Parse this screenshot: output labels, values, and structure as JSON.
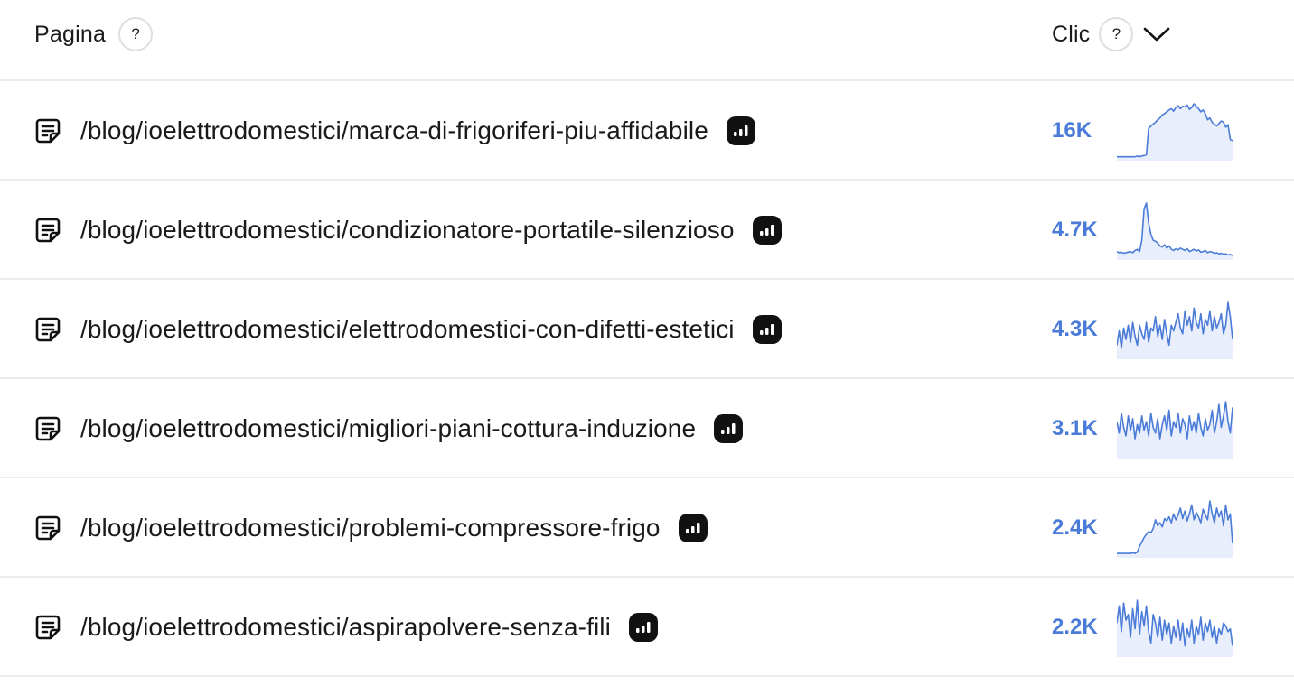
{
  "header": {
    "page_label": "Pagina",
    "clicks_label": "Clic",
    "help_glyph": "?"
  },
  "colors": {
    "accent": "#4a7bd8",
    "spark_fill": "#e8eefb",
    "badge_bg": "#111111",
    "divider": "#ececec"
  },
  "rows": [
    {
      "url": "/blog/ioelettrodomestici/marca-di-frigoriferi-piu-affidabile",
      "clicks": "16K",
      "trend": [
        2,
        2,
        2,
        2,
        2,
        2,
        2,
        2,
        2,
        3,
        2,
        3,
        4,
        5,
        48,
        52,
        55,
        58,
        62,
        65,
        70,
        72,
        75,
        78,
        80,
        76,
        82,
        85,
        80,
        84,
        83,
        86,
        79,
        82,
        88,
        84,
        80,
        75,
        78,
        72,
        62,
        65,
        58,
        55,
        52,
        56,
        60,
        58,
        50,
        54,
        30,
        28
      ]
    },
    {
      "url": "/blog/ioelettrodomestici/condizionatore-portatile-silenzioso",
      "clicks": "4.7K",
      "trend": [
        10,
        8,
        9,
        7,
        8,
        9,
        10,
        8,
        12,
        14,
        10,
        30,
        85,
        95,
        60,
        40,
        30,
        28,
        25,
        20,
        18,
        22,
        16,
        20,
        14,
        12,
        15,
        13,
        16,
        14,
        12,
        15,
        10,
        12,
        14,
        11,
        13,
        9,
        10,
        12,
        8,
        10,
        9,
        7,
        8,
        6,
        7,
        5,
        6,
        4,
        5,
        3
      ]
    },
    {
      "url": "/blog/ioelettrodomestici/elettrodomestici-con-difetti-estetici",
      "clicks": "4.3K",
      "trend": [
        20,
        45,
        15,
        50,
        30,
        55,
        25,
        60,
        35,
        20,
        55,
        40,
        30,
        60,
        25,
        50,
        45,
        70,
        35,
        55,
        30,
        65,
        40,
        20,
        55,
        45,
        60,
        75,
        50,
        40,
        80,
        55,
        70,
        45,
        85,
        60,
        50,
        75,
        40,
        65,
        55,
        80,
        45,
        70,
        50,
        60,
        75,
        40,
        55,
        95,
        70,
        30
      ]
    },
    {
      "url": "/blog/ioelettrodomestici/migliori-piani-cottura-induzione",
      "clicks": "3.1K",
      "trend": [
        60,
        40,
        75,
        50,
        35,
        70,
        45,
        65,
        30,
        55,
        40,
        70,
        45,
        60,
        35,
        75,
        50,
        40,
        65,
        30,
        55,
        70,
        45,
        80,
        35,
        60,
        50,
        75,
        40,
        65,
        55,
        30,
        70,
        45,
        60,
        40,
        75,
        50,
        35,
        65,
        45,
        55,
        80,
        40,
        60,
        90,
        50,
        70,
        95,
        60,
        40,
        85
      ]
    },
    {
      "url": "/blog/ioelettrodomestici/problemi-compressore-frigo",
      "clicks": "2.4K",
      "trend": [
        3,
        3,
        3,
        3,
        3,
        3,
        3,
        4,
        3,
        5,
        15,
        22,
        30,
        35,
        40,
        38,
        45,
        60,
        50,
        55,
        48,
        62,
        58,
        65,
        55,
        70,
        60,
        68,
        80,
        62,
        75,
        58,
        70,
        85,
        60,
        72,
        65,
        55,
        78,
        68,
        60,
        92,
        70,
        55,
        80,
        65,
        75,
        50,
        85,
        60,
        70,
        20
      ]
    },
    {
      "url": "/blog/ioelettrodomestici/aspirapolvere-senza-fili",
      "clicks": "2.2K",
      "trend": [
        55,
        85,
        40,
        90,
        60,
        70,
        30,
        80,
        45,
        95,
        35,
        75,
        50,
        85,
        40,
        20,
        70,
        55,
        30,
        65,
        25,
        60,
        35,
        55,
        20,
        50,
        30,
        60,
        25,
        55,
        15,
        45,
        30,
        60,
        20,
        50,
        35,
        65,
        25,
        55,
        40,
        60,
        30,
        50,
        20,
        45,
        35,
        55,
        50,
        40,
        45,
        15
      ]
    }
  ]
}
